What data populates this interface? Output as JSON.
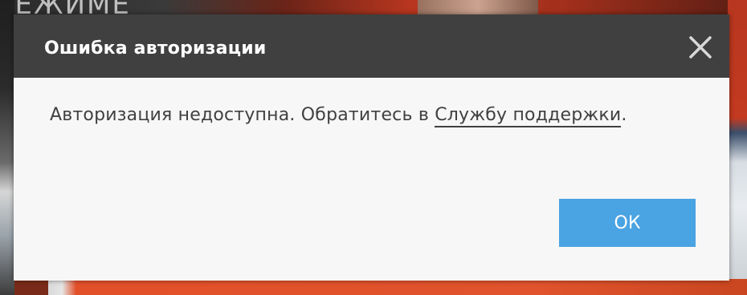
{
  "background": {
    "top_text": "РЕЖИМЕ"
  },
  "dialog": {
    "title": "Ошибка авторизации",
    "message_prefix": "Авторизация недоступна. Обратитесь в ",
    "support_link": "Службу поддержки",
    "message_suffix": ".",
    "ok_label": "ОК",
    "close_icon": "close-icon",
    "colors": {
      "header_bg": "#404040",
      "body_bg": "#f7f7f7",
      "ok_button_bg": "#4aa3e2",
      "text": "#404040"
    }
  }
}
